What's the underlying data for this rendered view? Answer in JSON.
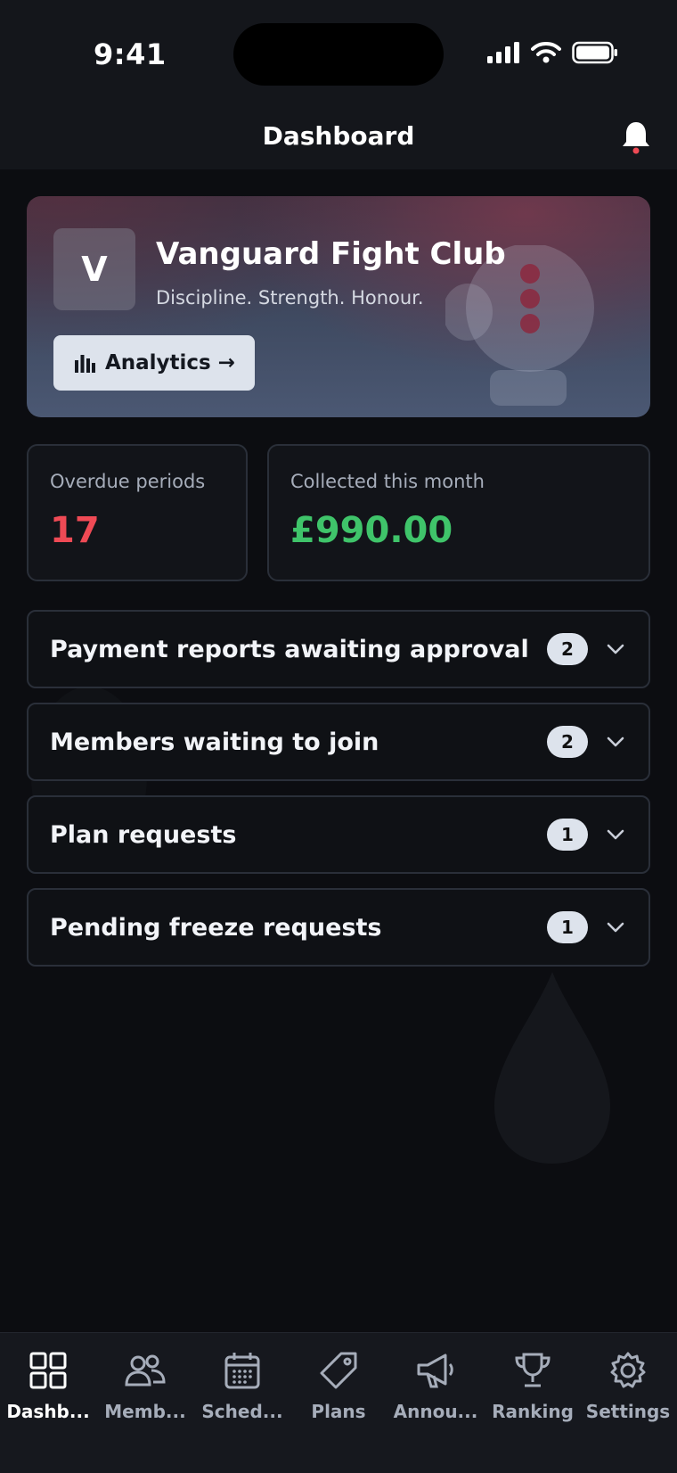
{
  "status_bar": {
    "time": "9:41"
  },
  "header": {
    "title": "Dashboard"
  },
  "club": {
    "initial": "V",
    "name": "Vanguard Fight Club",
    "tagline": "Discipline. Strength. Honour.",
    "analytics_label": "Analytics →"
  },
  "stats": {
    "overdue": {
      "label": "Overdue periods",
      "value": "17",
      "color": "#ef4a55"
    },
    "collected": {
      "label": "Collected this month",
      "value": "£990.00",
      "color": "#3fc46a"
    }
  },
  "sections": [
    {
      "label": "Payment reports awaiting approval",
      "count": "2"
    },
    {
      "label": "Members waiting to join",
      "count": "2"
    },
    {
      "label": "Plan requests",
      "count": "1"
    },
    {
      "label": "Pending freeze requests",
      "count": "1"
    }
  ],
  "tabs": [
    {
      "label": "Dashb...",
      "icon": "grid-icon",
      "active": true
    },
    {
      "label": "Memb...",
      "icon": "users-icon"
    },
    {
      "label": "Sched...",
      "icon": "calendar-icon"
    },
    {
      "label": "Plans",
      "icon": "tag-icon"
    },
    {
      "label": "Annou...",
      "icon": "megaphone-icon"
    },
    {
      "label": "Ranking",
      "icon": "trophy-icon"
    },
    {
      "label": "Settings",
      "icon": "gear-icon"
    }
  ],
  "colors": {
    "background": "#0c0d11",
    "surface": "#121419",
    "border": "#2a2f39",
    "badge": "#dde3ec",
    "alert": "#ef4a55",
    "success": "#3fc46a"
  }
}
